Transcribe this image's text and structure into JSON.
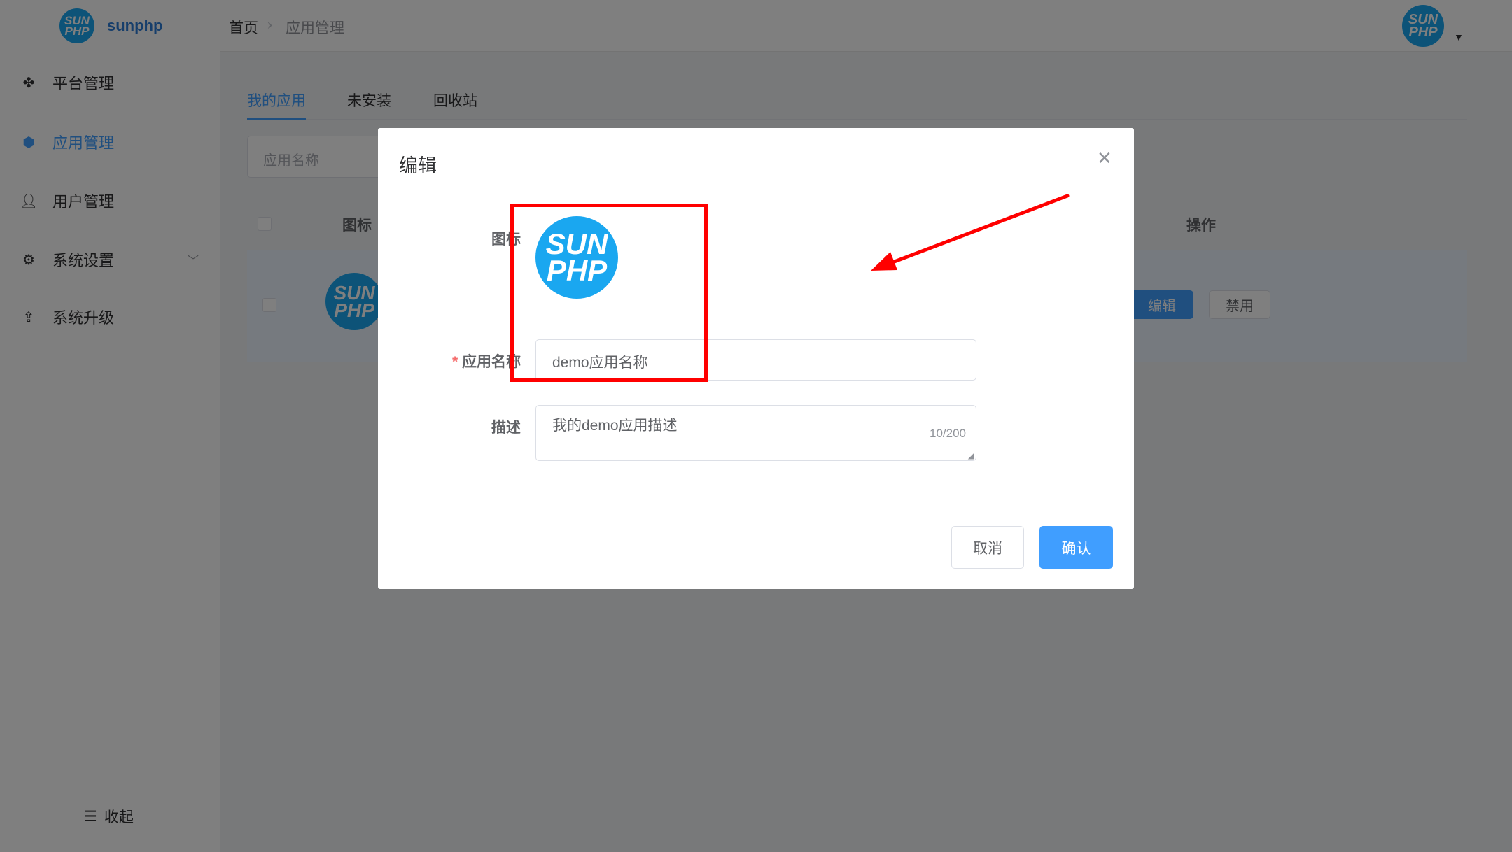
{
  "sidebar": {
    "brand": "sunphp",
    "logo_text": [
      "SUN",
      "PHP"
    ],
    "items": [
      {
        "label": "平台管理",
        "icon": "grid-icon"
      },
      {
        "label": "应用管理",
        "icon": "cube-icon",
        "active": true
      },
      {
        "label": "用户管理",
        "icon": "user-icon"
      },
      {
        "label": "系统设置",
        "icon": "gear-icon"
      },
      {
        "label": "系统升级",
        "icon": "upload-icon"
      }
    ],
    "collapse_label": "收起"
  },
  "header": {
    "breadcrumb": [
      "首页",
      "应用管理"
    ]
  },
  "tabs": [
    {
      "label": "我的应用",
      "active": true
    },
    {
      "label": "未安装"
    },
    {
      "label": "回收站"
    }
  ],
  "search": {
    "placeholder": "应用名称"
  },
  "table": {
    "headers": {
      "icon": "图标",
      "actions": "操作"
    },
    "row": {
      "edit": "编辑",
      "disable": "禁用"
    }
  },
  "dialog": {
    "title": "编辑",
    "icon_label": "图标",
    "name_label": "应用名称",
    "name_value": "demo应用名称",
    "desc_label": "描述",
    "desc_value": "我的demo应用描述",
    "desc_count": "10/200",
    "cancel": "取消",
    "confirm": "确认"
  },
  "colors": {
    "primary": "#409eff",
    "annotation": "#ff0000",
    "logo": "#1aa7f0"
  }
}
